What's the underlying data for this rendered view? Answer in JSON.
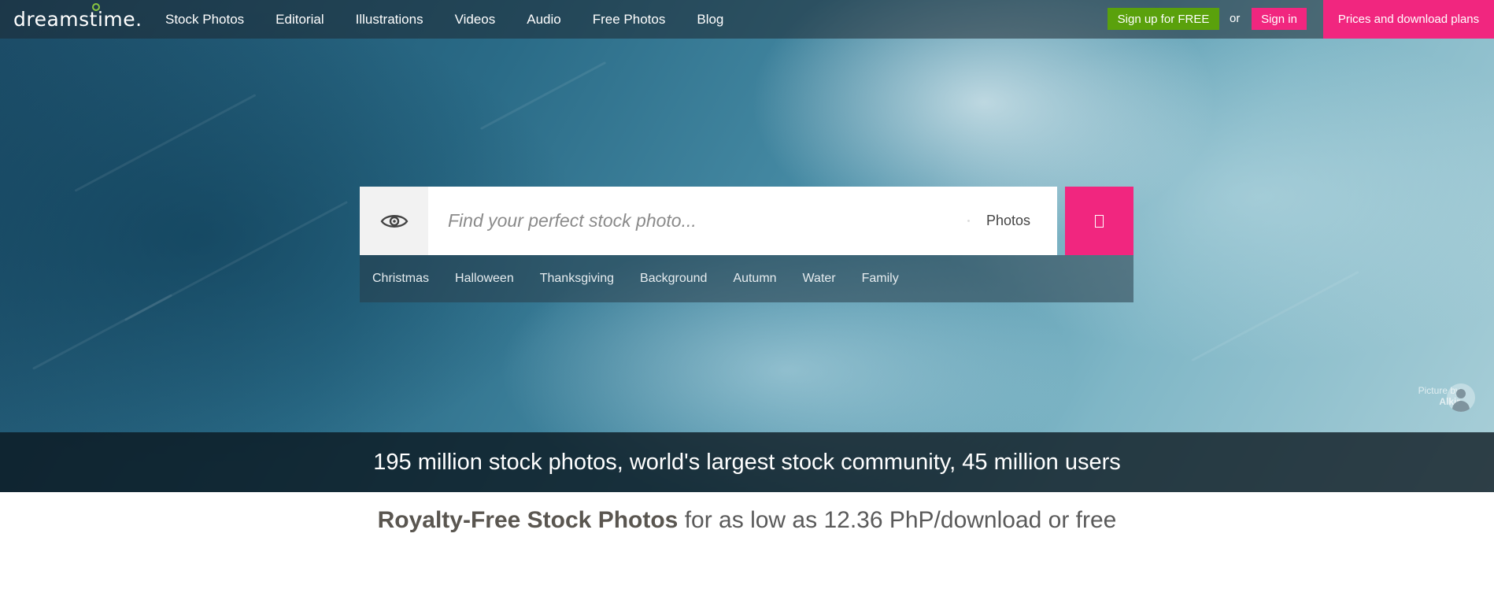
{
  "header": {
    "logo": "dreamstime.",
    "nav": [
      "Stock Photos",
      "Editorial",
      "Illustrations",
      "Videos",
      "Audio",
      "Free Photos",
      "Blog"
    ],
    "signup_label": "Sign up for FREE",
    "or_label": "or",
    "signin_label": "Sign in",
    "prices_label": "Prices and download plans"
  },
  "search": {
    "placeholder": "Find your perfect stock photo...",
    "type_selected": "Photos",
    "icons": {
      "visual_search": "eye-icon",
      "submit": "search-icon"
    }
  },
  "tags": [
    "Christmas",
    "Halloween",
    "Thanksgiving",
    "Background",
    "Autumn",
    "Water",
    "Family"
  ],
  "credit": {
    "prefix": "Picture by",
    "author": "Alkir"
  },
  "stats_text": "195 million stock photos, world's largest stock community, 45 million users",
  "tagline": {
    "strong": "Royalty-Free Stock Photos",
    "rest": " for as low as 12.36 PhP/download or free"
  },
  "colors": {
    "accent_pink": "#f1267f",
    "signup_green": "#5aa10c"
  }
}
